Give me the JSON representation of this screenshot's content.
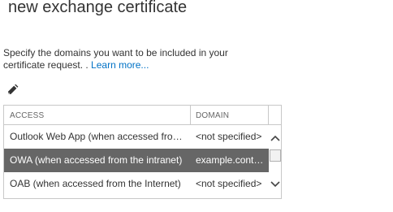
{
  "page": {
    "title": "new exchange certificate"
  },
  "instructions": {
    "text": "Specify the domains you want to be included in your certificate request. . ",
    "learn_more": "Learn more..."
  },
  "toolbar": {
    "edit_icon": "pencil-icon"
  },
  "grid": {
    "columns": {
      "access": "ACCESS",
      "domain": "DOMAIN"
    },
    "rows": [
      {
        "access": "Outlook Web App (when accessed from the Internet)",
        "domain": "<not specified>",
        "selected": false
      },
      {
        "access": "OWA (when accessed from the intranet)",
        "domain": "example.contoso.com",
        "selected": true
      },
      {
        "access": "OAB (when accessed from the Internet)",
        "domain": "<not specified>",
        "selected": false
      }
    ],
    "scrollbar": {
      "up_icon": "chevron-up-icon",
      "down_icon": "chevron-down-icon"
    }
  },
  "colors": {
    "link": "#0072c6",
    "selected_row": "#666666",
    "border": "#c8c8c8",
    "text": "#333333"
  }
}
